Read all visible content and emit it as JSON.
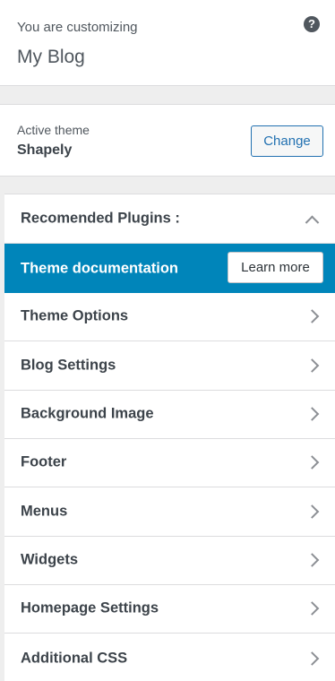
{
  "header": {
    "preface": "You are customizing",
    "site_title": "My Blog",
    "help_symbol": "?"
  },
  "theme": {
    "label": "Active theme",
    "name": "Shapely",
    "change_label": "Change"
  },
  "recommended": {
    "title": "Recomended Plugins :"
  },
  "docs": {
    "title": "Theme documentation",
    "button_label": "Learn more"
  },
  "sections": [
    {
      "label": "Theme Options"
    },
    {
      "label": "Blog Settings"
    },
    {
      "label": "Background Image"
    },
    {
      "label": "Footer"
    },
    {
      "label": "Menus"
    },
    {
      "label": "Widgets"
    },
    {
      "label": "Homepage Settings"
    },
    {
      "label": "Additional CSS"
    }
  ],
  "colors": {
    "accent": "#0085ba",
    "button_border": "#2271b1"
  }
}
